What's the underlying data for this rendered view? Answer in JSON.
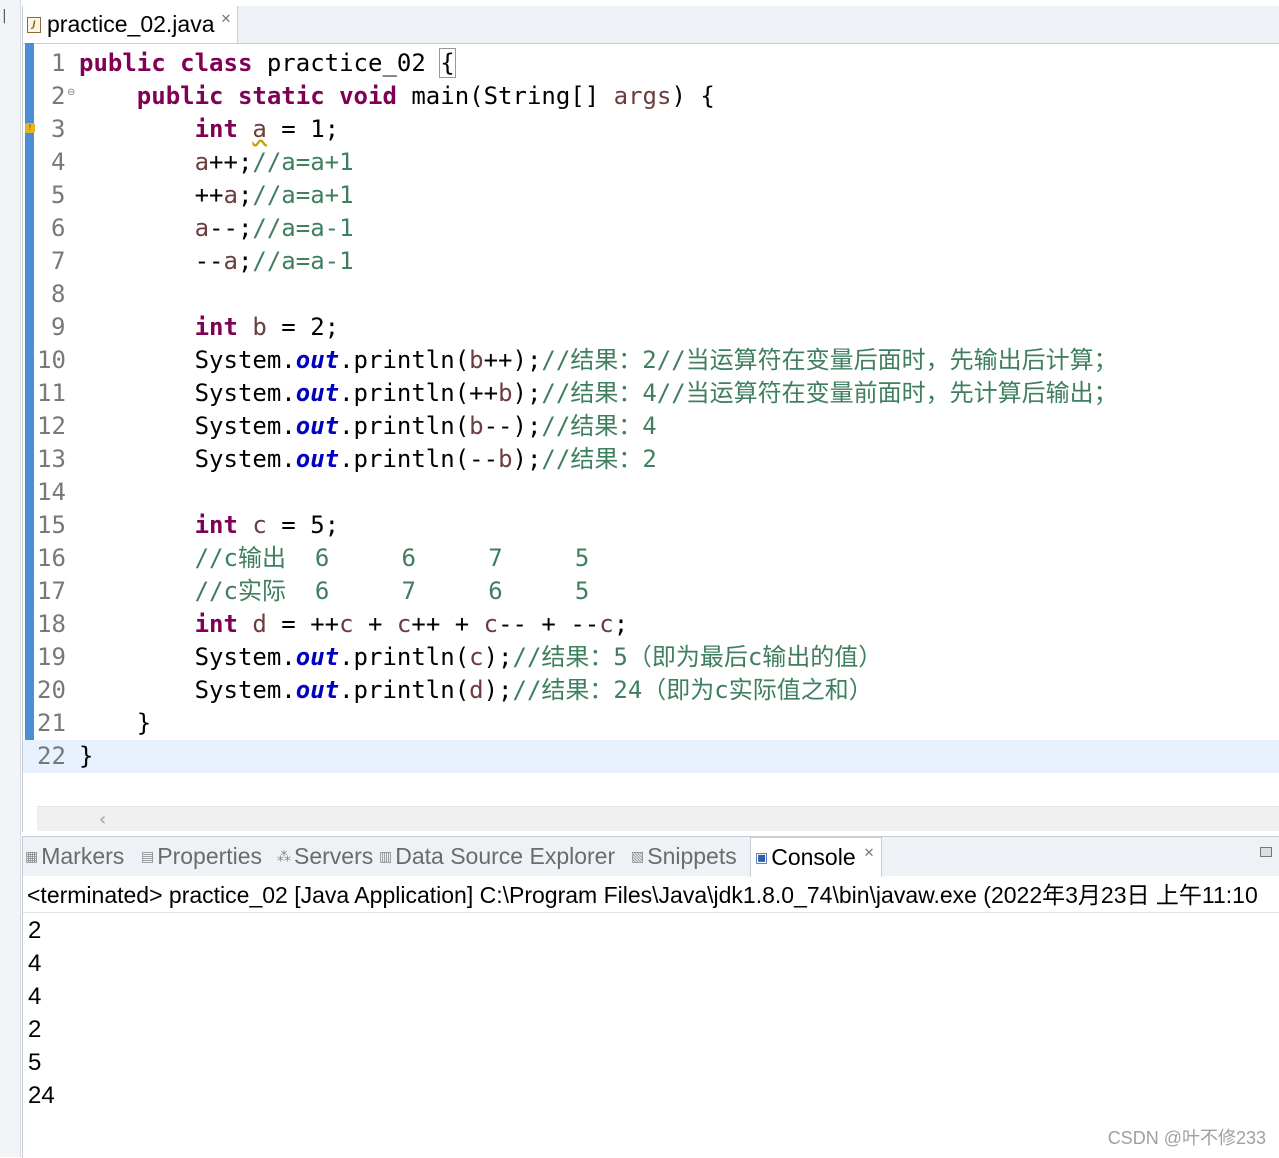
{
  "editor": {
    "tab_label": "practice_02.java",
    "lines": [
      {
        "num": "1",
        "tokens": [
          {
            "t": "kw",
            "v": "public"
          },
          {
            "t": "",
            "v": " "
          },
          {
            "t": "kw",
            "v": "class"
          },
          {
            "t": "",
            "v": " practice_02 "
          },
          {
            "t": "brace",
            "v": "{"
          }
        ]
      },
      {
        "num": "2",
        "fold": "⊖",
        "tokens": [
          {
            "t": "",
            "v": "    "
          },
          {
            "t": "kw",
            "v": "public"
          },
          {
            "t": "",
            "v": " "
          },
          {
            "t": "kw",
            "v": "static"
          },
          {
            "t": "",
            "v": " "
          },
          {
            "t": "kw",
            "v": "void"
          },
          {
            "t": "",
            "v": " main(String[] "
          },
          {
            "t": "var",
            "v": "args"
          },
          {
            "t": "",
            "v": ") {"
          }
        ]
      },
      {
        "num": "3",
        "warn": true,
        "tokens": [
          {
            "t": "",
            "v": "        "
          },
          {
            "t": "kw",
            "v": "int"
          },
          {
            "t": "",
            "v": " "
          },
          {
            "t": "varw",
            "v": "a"
          },
          {
            "t": "",
            "v": " = 1;"
          }
        ]
      },
      {
        "num": "4",
        "tokens": [
          {
            "t": "",
            "v": "        "
          },
          {
            "t": "var",
            "v": "a"
          },
          {
            "t": "",
            "v": "++;"
          },
          {
            "t": "cm",
            "v": "//a=a+1"
          }
        ]
      },
      {
        "num": "5",
        "tokens": [
          {
            "t": "",
            "v": "        ++"
          },
          {
            "t": "var",
            "v": "a"
          },
          {
            "t": "",
            "v": ";"
          },
          {
            "t": "cm",
            "v": "//a=a+1"
          }
        ]
      },
      {
        "num": "6",
        "tokens": [
          {
            "t": "",
            "v": "        "
          },
          {
            "t": "var",
            "v": "a"
          },
          {
            "t": "",
            "v": "--;"
          },
          {
            "t": "cm",
            "v": "//a=a-1"
          }
        ]
      },
      {
        "num": "7",
        "tokens": [
          {
            "t": "",
            "v": "        --"
          },
          {
            "t": "var",
            "v": "a"
          },
          {
            "t": "",
            "v": ";"
          },
          {
            "t": "cm",
            "v": "//a=a-1"
          }
        ]
      },
      {
        "num": "8",
        "tokens": []
      },
      {
        "num": "9",
        "tokens": [
          {
            "t": "",
            "v": "        "
          },
          {
            "t": "kw",
            "v": "int"
          },
          {
            "t": "",
            "v": " "
          },
          {
            "t": "var",
            "v": "b"
          },
          {
            "t": "",
            "v": " = 2;"
          }
        ]
      },
      {
        "num": "10",
        "tokens": [
          {
            "t": "",
            "v": "        System."
          },
          {
            "t": "fld",
            "v": "out"
          },
          {
            "t": "",
            "v": ".println("
          },
          {
            "t": "var",
            "v": "b"
          },
          {
            "t": "",
            "v": "++);"
          },
          {
            "t": "cm",
            "v": "//结果：2//当运算符在变量后面时，先输出后计算；"
          }
        ]
      },
      {
        "num": "11",
        "tokens": [
          {
            "t": "",
            "v": "        System."
          },
          {
            "t": "fld",
            "v": "out"
          },
          {
            "t": "",
            "v": ".println(++"
          },
          {
            "t": "var",
            "v": "b"
          },
          {
            "t": "",
            "v": ");"
          },
          {
            "t": "cm",
            "v": "//结果：4//当运算符在变量前面时，先计算后输出；"
          }
        ]
      },
      {
        "num": "12",
        "tokens": [
          {
            "t": "",
            "v": "        System."
          },
          {
            "t": "fld",
            "v": "out"
          },
          {
            "t": "",
            "v": ".println("
          },
          {
            "t": "var",
            "v": "b"
          },
          {
            "t": "",
            "v": "--);"
          },
          {
            "t": "cm",
            "v": "//结果：4"
          }
        ]
      },
      {
        "num": "13",
        "tokens": [
          {
            "t": "",
            "v": "        System."
          },
          {
            "t": "fld",
            "v": "out"
          },
          {
            "t": "",
            "v": ".println(--"
          },
          {
            "t": "var",
            "v": "b"
          },
          {
            "t": "",
            "v": ");"
          },
          {
            "t": "cm",
            "v": "//结果：2"
          }
        ]
      },
      {
        "num": "14",
        "tokens": []
      },
      {
        "num": "15",
        "tokens": [
          {
            "t": "",
            "v": "        "
          },
          {
            "t": "kw",
            "v": "int"
          },
          {
            "t": "",
            "v": " "
          },
          {
            "t": "var",
            "v": "c"
          },
          {
            "t": "",
            "v": " = 5;"
          }
        ]
      },
      {
        "num": "16",
        "tokens": [
          {
            "t": "",
            "v": "        "
          },
          {
            "t": "cm",
            "v": "//c输出  6     6     7     5"
          }
        ]
      },
      {
        "num": "17",
        "tokens": [
          {
            "t": "",
            "v": "        "
          },
          {
            "t": "cm",
            "v": "//c实际  6     7     6     5"
          }
        ]
      },
      {
        "num": "18",
        "tokens": [
          {
            "t": "",
            "v": "        "
          },
          {
            "t": "kw",
            "v": "int"
          },
          {
            "t": "",
            "v": " "
          },
          {
            "t": "var",
            "v": "d"
          },
          {
            "t": "",
            "v": " = ++"
          },
          {
            "t": "var",
            "v": "c"
          },
          {
            "t": "",
            "v": " + "
          },
          {
            "t": "var",
            "v": "c"
          },
          {
            "t": "",
            "v": "++ + "
          },
          {
            "t": "var",
            "v": "c"
          },
          {
            "t": "",
            "v": "-- + --"
          },
          {
            "t": "var",
            "v": "c"
          },
          {
            "t": "",
            "v": ";"
          }
        ]
      },
      {
        "num": "19",
        "tokens": [
          {
            "t": "",
            "v": "        System."
          },
          {
            "t": "fld",
            "v": "out"
          },
          {
            "t": "",
            "v": ".println("
          },
          {
            "t": "var",
            "v": "c"
          },
          {
            "t": "",
            "v": ");"
          },
          {
            "t": "cm",
            "v": "//结果：5（即为最后c输出的值）"
          }
        ]
      },
      {
        "num": "20",
        "tokens": [
          {
            "t": "",
            "v": "        System."
          },
          {
            "t": "fld",
            "v": "out"
          },
          {
            "t": "",
            "v": ".println("
          },
          {
            "t": "var",
            "v": "d"
          },
          {
            "t": "",
            "v": ");"
          },
          {
            "t": "cm",
            "v": "//结果：24（即为c实际值之和）"
          }
        ]
      },
      {
        "num": "21",
        "tokens": [
          {
            "t": "",
            "v": "    }"
          }
        ]
      },
      {
        "num": "22",
        "current": true,
        "tokens": [
          {
            "t": "",
            "v": "}"
          }
        ]
      }
    ]
  },
  "panel": {
    "tabs": [
      {
        "label": "Markers",
        "icon": "markers-icon",
        "glyph": "▦",
        "active": false
      },
      {
        "label": "Properties",
        "icon": "properties-icon",
        "glyph": "▤",
        "active": false
      },
      {
        "label": "Servers",
        "icon": "servers-icon",
        "glyph": "⁂",
        "active": false
      },
      {
        "label": "Data Source Explorer",
        "icon": "data-source-icon",
        "glyph": "▥",
        "active": false
      },
      {
        "label": "Snippets",
        "icon": "snippets-icon",
        "glyph": "▧",
        "active": false
      },
      {
        "label": "Console",
        "icon": "console-icon",
        "glyph": "▣",
        "active": true
      }
    ],
    "console_header": "<terminated> practice_02 [Java Application] C:\\Program Files\\Java\\jdk1.8.0_74\\bin\\javaw.exe (2022年3月23日 上午11:10",
    "output": [
      "2",
      "4",
      "4",
      "2",
      "5",
      "24"
    ]
  },
  "watermark": "CSDN @叶不修233"
}
